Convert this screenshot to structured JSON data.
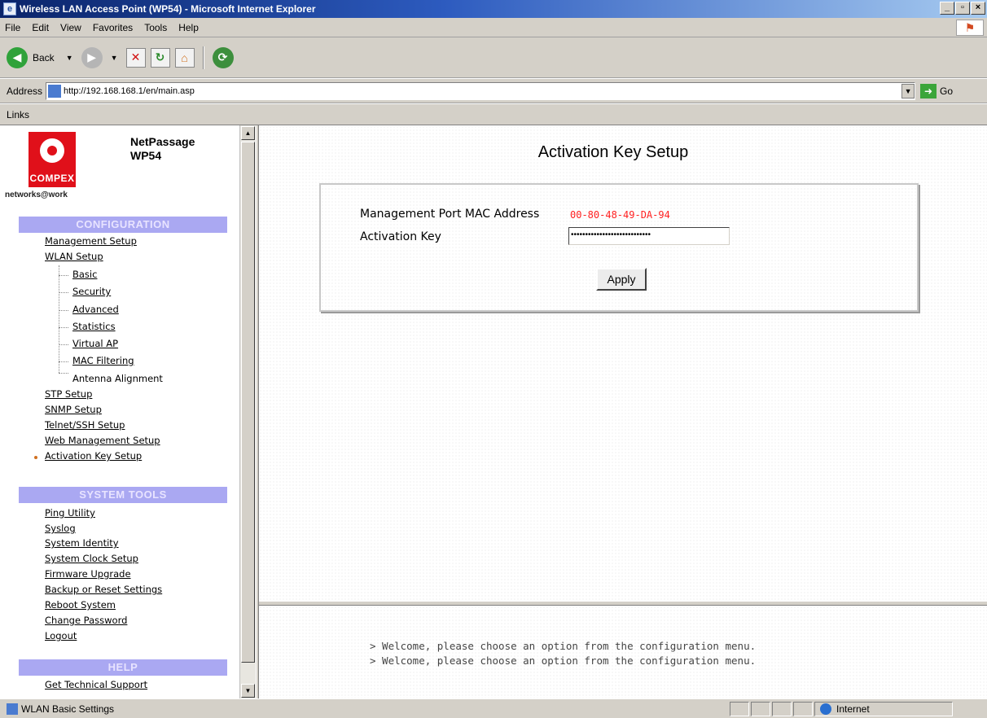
{
  "window": {
    "title": "Wireless LAN Access Point (WP54) - Microsoft Internet Explorer",
    "minimize": "_",
    "maximize": "▫",
    "close": "×"
  },
  "menu": [
    "File",
    "Edit",
    "View",
    "Favorites",
    "Tools",
    "Help"
  ],
  "toolbar": {
    "back_label": "Back"
  },
  "address": {
    "label": "Address",
    "url": "http://192.168.168.1/en/main.asp",
    "go_label": "Go"
  },
  "links_label": "Links",
  "sidebar": {
    "logo_text": "COMPEX",
    "tagline": "networks@work",
    "product_line1": "NetPassage",
    "product_line2": "WP54",
    "configuration": {
      "heading": "CONFIGURATION",
      "items": [
        "Management Setup",
        "WLAN Setup",
        "Basic",
        "Security",
        "Advanced",
        "Statistics",
        "Virtual AP",
        "MAC Filtering",
        "Antenna Alignment",
        "STP Setup",
        "SNMP Setup",
        "Telnet/SSH Setup",
        "Web Management Setup",
        "Activation Key Setup"
      ]
    },
    "system_tools": {
      "heading": "SYSTEM TOOLS",
      "items": [
        "Ping Utility",
        "Syslog",
        "System Identity",
        "System Clock Setup",
        "Firmware Upgrade",
        "Backup or Reset Settings",
        "Reboot System",
        "Change Password",
        "Logout"
      ]
    },
    "help": {
      "heading": "HELP",
      "items": [
        "Get Technical Support"
      ]
    }
  },
  "main": {
    "title": "Activation Key Setup",
    "mac_label": "Management Port MAC Address",
    "mac_value": "00-80-48-49-DA-94",
    "key_label": "Activation Key",
    "key_value": "••••••••••••••••••••••••••••",
    "apply_label": "Apply"
  },
  "status_messages": [
    "> Welcome, please choose an option from the configuration menu.",
    "> Welcome, please choose an option from the configuration menu."
  ],
  "statusbar": {
    "text": "WLAN Basic Settings",
    "zone": "Internet"
  }
}
